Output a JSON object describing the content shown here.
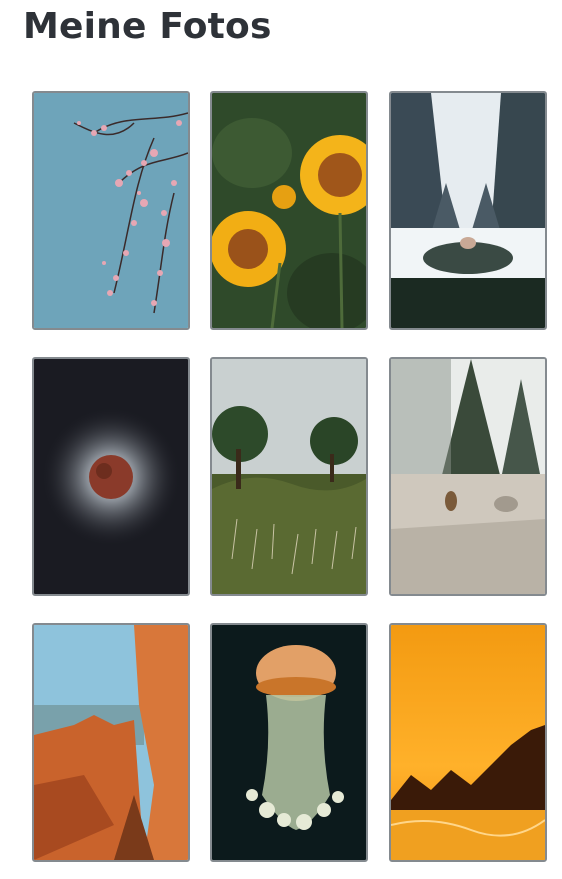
{
  "header": {
    "title": "Meine Fotos"
  },
  "gallery": {
    "photos": [
      {
        "subject": "cherry-blossom-branch",
        "colors": {
          "sky": "#6fa3b8",
          "blossom": "#e6a7b4"
        }
      },
      {
        "subject": "sunflowers",
        "colors": {
          "petal": "#f4b41a",
          "center": "#a0561a",
          "leaf": "#2f4a2a"
        }
      },
      {
        "subject": "snowy-forest",
        "colors": {
          "snow": "#eef2f5",
          "tree": "#2f3f48",
          "jacket": "#1b2a22"
        }
      },
      {
        "subject": "solar-eclipse",
        "colors": {
          "space": "#1a1b22",
          "moon": "#8a3a2a",
          "corona": "#e8eef4"
        }
      },
      {
        "subject": "trees-in-meadow",
        "colors": {
          "sky": "#c9d0d0",
          "grass": "#4a5a2a",
          "tree": "#2d4a2a"
        }
      },
      {
        "subject": "chipmunk-on-rock",
        "colors": {
          "rock": "#cfc8bd",
          "tree": "#3a4a3a",
          "sky": "#e9ecea"
        }
      },
      {
        "subject": "red-rock-canyon",
        "colors": {
          "sky": "#8ec3dc",
          "rock": "#c9632c",
          "shade": "#7a3a1a"
        }
      },
      {
        "subject": "jellyfish",
        "colors": {
          "water": "#0c1a1c",
          "bell": "#e2a067",
          "tentacle": "#b5c7a4"
        }
      },
      {
        "subject": "sunset-beach",
        "colors": {
          "sky": "#f39a11",
          "silhouette": "#3a1a08",
          "water": "#f0a020"
        }
      }
    ]
  }
}
